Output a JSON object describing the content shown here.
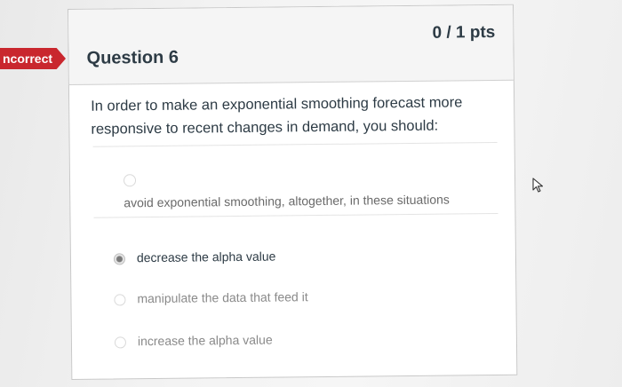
{
  "badge": {
    "label": "ncorrect"
  },
  "question": {
    "title": "Question 6",
    "points": "0 / 1 pts",
    "text": "In order to make an exponential smoothing forecast more responsive to recent changes in demand, you should:"
  },
  "answers": [
    {
      "label": "avoid exponential smoothing, altogether, in these situations",
      "selected": false
    },
    {
      "label": "decrease the alpha value",
      "selected": true
    },
    {
      "label": "manipulate the data that feed it",
      "selected": false
    },
    {
      "label": "increase the alpha value",
      "selected": false
    }
  ],
  "icons": {
    "cursor": "mouse-pointer-icon",
    "radio": "radio-button-icon"
  },
  "colors": {
    "incorrect_badge": "#c9272e",
    "text": "#2d3b45"
  }
}
